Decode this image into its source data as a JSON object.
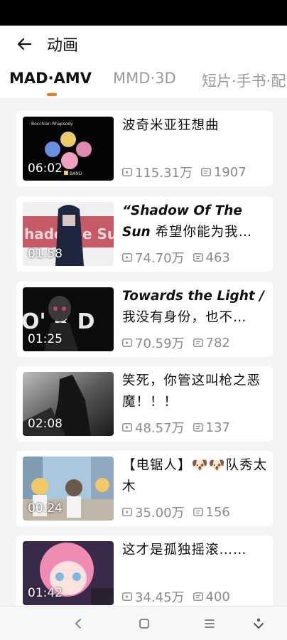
{
  "header": {
    "title": "动画"
  },
  "tabs": [
    {
      "label": "MAD·AMV",
      "active": true
    },
    {
      "label": "MMD·3D",
      "active": false
    },
    {
      "label": "短片·手书·配音",
      "active": false
    }
  ],
  "accent_color": "#f07a14",
  "videos": [
    {
      "thumb_text": "Bocchian Rhapsody",
      "thumb_text_2": "BAND",
      "duration": "06:02",
      "title_zh": "波奇米亚狂想曲",
      "views": "115.31万",
      "danmaku": "1907"
    },
    {
      "thumb_text": "hado",
      "thumb_text_2": "e Su",
      "duration": "01:58",
      "title_en": "“Shadow Of The Sun",
      "title_zh": "希望你能为我…",
      "views": "74.70万",
      "danmaku": "463"
    },
    {
      "thumb_text": "O' R D",
      "duration": "01:25",
      "title_en": "Towards the Light /",
      "title_zh": "我没有身份，也不…",
      "views": "70.59万",
      "danmaku": "782"
    },
    {
      "duration": "02:08",
      "title_zh": "笑死，你管这叫枪之恶魔！！！",
      "views": "48.57万",
      "danmaku": "137"
    },
    {
      "duration": "00:24",
      "title_zh": "【电锯人】🐶🐶队秀太木",
      "views": "35.00万",
      "danmaku": "156"
    },
    {
      "duration": "01:42",
      "title_zh": "这才是孤独摇滚……",
      "views": "34.45万",
      "danmaku": "400"
    }
  ],
  "icons": {
    "back": "arrow-left-icon",
    "views": "play-count-icon",
    "danmaku": "danmaku-count-icon",
    "nav": [
      "nav-back-icon",
      "nav-home-icon",
      "nav-menu-icon",
      "nav-assist-icon"
    ]
  }
}
